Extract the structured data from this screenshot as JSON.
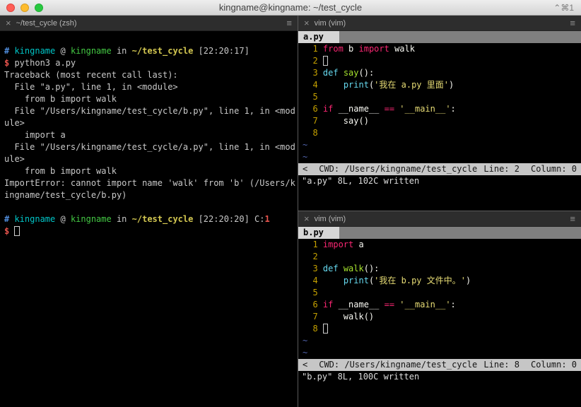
{
  "titlebar": {
    "title": "kingname@kingname: ~/test_cycle",
    "shortcut": "⌃⌘1"
  },
  "colors": {
    "traffic_red": "#ff5f57",
    "traffic_yellow": "#febc2e",
    "traffic_green": "#28c840",
    "keyword_pink": "#f92672",
    "builtin_cyan": "#66d9ef",
    "function_green": "#a6e22e",
    "string_yellow": "#e6db74",
    "line_number_yellow": "#c4a000",
    "prompt_path_yellow": "#d3c751",
    "prompt_red": "#e8544d",
    "statusline_gray": "#c6c6c6"
  },
  "left_pane": {
    "tab": {
      "close": "×",
      "title": "~/test_cycle (zsh)",
      "menu": "≡"
    },
    "lines": [
      [
        {
          "t": "# ",
          "c": "c-blue"
        },
        {
          "t": "kingname",
          "c": "c-cyan"
        },
        {
          "t": " @ ",
          "c": "c-fg"
        },
        {
          "t": "kingname",
          "c": "c-green"
        },
        {
          "t": " in ",
          "c": "c-fg"
        },
        {
          "t": "~/test_cycle",
          "c": "c-yellow"
        },
        {
          "t": " [22:20:17]",
          "c": "c-fg"
        }
      ],
      [
        {
          "t": "$ ",
          "c": "c-red"
        },
        {
          "t": "python3 a.py",
          "c": "c-fg"
        }
      ],
      [
        {
          "t": "Traceback (most recent call last):",
          "c": "c-fg"
        }
      ],
      [
        {
          "t": "  File \"a.py\", line 1, in <module>",
          "c": "c-fg"
        }
      ],
      [
        {
          "t": "    from b import walk",
          "c": "c-fg"
        }
      ],
      [
        {
          "t": "  File \"/Users/kingname/test_cycle/b.py\", line 1, in <mod",
          "c": "c-fg"
        }
      ],
      [
        {
          "t": "ule>",
          "c": "c-fg"
        }
      ],
      [
        {
          "t": "    import a",
          "c": "c-fg"
        }
      ],
      [
        {
          "t": "  File \"/Users/kingname/test_cycle/a.py\", line 1, in <mod",
          "c": "c-fg"
        }
      ],
      [
        {
          "t": "ule>",
          "c": "c-fg"
        }
      ],
      [
        {
          "t": "    from b import walk",
          "c": "c-fg"
        }
      ],
      [
        {
          "t": "ImportError: cannot import name 'walk' from 'b' (/Users/k",
          "c": "c-fg"
        }
      ],
      [
        {
          "t": "ingname/test_cycle/b.py)",
          "c": "c-fg"
        }
      ],
      [
        {
          "t": " ",
          "c": "c-fg"
        }
      ],
      [
        {
          "t": "# ",
          "c": "c-blue"
        },
        {
          "t": "kingname",
          "c": "c-cyan"
        },
        {
          "t": " @ ",
          "c": "c-fg"
        },
        {
          "t": "kingname",
          "c": "c-green"
        },
        {
          "t": " in ",
          "c": "c-fg"
        },
        {
          "t": "~/test_cycle",
          "c": "c-yellow"
        },
        {
          "t": " [22:20:20] ",
          "c": "c-fg"
        },
        {
          "t": "C:",
          "c": "c-fg"
        },
        {
          "t": "1",
          "c": "c-red"
        }
      ],
      [
        {
          "t": "$ ",
          "c": "c-red"
        },
        {
          "t": " ",
          "c": "cursor"
        }
      ]
    ]
  },
  "vim_a": {
    "tab": {
      "close": "×",
      "title": "vim (vim)",
      "menu": "≡"
    },
    "file_tab": "a.py",
    "code": [
      [
        {
          "t": "  1 ",
          "c": "ln"
        },
        {
          "t": "from",
          "c": "kw"
        },
        {
          "t": " b ",
          "c": "fg"
        },
        {
          "t": "import",
          "c": "kw"
        },
        {
          "t": " walk",
          "c": "fg"
        }
      ],
      [
        {
          "t": "  2 ",
          "c": "ln"
        },
        {
          "t": " ",
          "c": "cursor"
        }
      ],
      [
        {
          "t": "  3 ",
          "c": "ln"
        },
        {
          "t": "def",
          "c": "ty"
        },
        {
          "t": " ",
          "c": "fg"
        },
        {
          "t": "say",
          "c": "fn"
        },
        {
          "t": "():",
          "c": "fg"
        }
      ],
      [
        {
          "t": "  4 ",
          "c": "ln"
        },
        {
          "t": "    ",
          "c": "fg"
        },
        {
          "t": "print",
          "c": "ty"
        },
        {
          "t": "(",
          "c": "fg"
        },
        {
          "t": "'我在 a.py 里面'",
          "c": "st"
        },
        {
          "t": ")",
          "c": "fg"
        }
      ],
      [
        {
          "t": "  5 ",
          "c": "ln"
        }
      ],
      [
        {
          "t": "  6 ",
          "c": "ln"
        },
        {
          "t": "if",
          "c": "kw"
        },
        {
          "t": " __name__ ",
          "c": "fg"
        },
        {
          "t": "==",
          "c": "kw"
        },
        {
          "t": " ",
          "c": "fg"
        },
        {
          "t": "'__main__'",
          "c": "st"
        },
        {
          "t": ":",
          "c": "fg"
        }
      ],
      [
        {
          "t": "  7 ",
          "c": "ln"
        },
        {
          "t": "    say()",
          "c": "fg"
        }
      ],
      [
        {
          "t": "  8 ",
          "c": "ln"
        }
      ],
      [
        {
          "t": "~",
          "c": "tilde"
        }
      ],
      [
        {
          "t": "~",
          "c": "tilde"
        }
      ]
    ],
    "status": {
      "back": "<",
      "cwd": "CWD: /Users/kingname/test_cycle",
      "line": "Line: 2",
      "column": "Column: 0"
    },
    "message": "\"a.py\" 8L, 102C written"
  },
  "vim_b": {
    "tab": {
      "close": "×",
      "title": "vim (vim)",
      "menu": "≡"
    },
    "file_tab": "b.py",
    "code": [
      [
        {
          "t": "  1 ",
          "c": "ln"
        },
        {
          "t": "import",
          "c": "kw"
        },
        {
          "t": " a",
          "c": "fg"
        }
      ],
      [
        {
          "t": "  2 ",
          "c": "ln"
        }
      ],
      [
        {
          "t": "  3 ",
          "c": "ln"
        },
        {
          "t": "def",
          "c": "ty"
        },
        {
          "t": " ",
          "c": "fg"
        },
        {
          "t": "walk",
          "c": "fn"
        },
        {
          "t": "():",
          "c": "fg"
        }
      ],
      [
        {
          "t": "  4 ",
          "c": "ln"
        },
        {
          "t": "    ",
          "c": "fg"
        },
        {
          "t": "print",
          "c": "ty"
        },
        {
          "t": "(",
          "c": "fg"
        },
        {
          "t": "'我在 b.py 文件中。'",
          "c": "st"
        },
        {
          "t": ")",
          "c": "fg"
        }
      ],
      [
        {
          "t": "  5 ",
          "c": "ln"
        }
      ],
      [
        {
          "t": "  6 ",
          "c": "ln"
        },
        {
          "t": "if",
          "c": "kw"
        },
        {
          "t": " __name__ ",
          "c": "fg"
        },
        {
          "t": "==",
          "c": "kw"
        },
        {
          "t": " ",
          "c": "fg"
        },
        {
          "t": "'__main__'",
          "c": "st"
        },
        {
          "t": ":",
          "c": "fg"
        }
      ],
      [
        {
          "t": "  7 ",
          "c": "ln"
        },
        {
          "t": "    walk()",
          "c": "fg"
        }
      ],
      [
        {
          "t": "  8 ",
          "c": "ln"
        },
        {
          "t": " ",
          "c": "cursor"
        }
      ],
      [
        {
          "t": "~",
          "c": "tilde"
        }
      ],
      [
        {
          "t": "~",
          "c": "tilde"
        }
      ]
    ],
    "status": {
      "back": "<",
      "cwd": "CWD: /Users/kingname/test_cycle",
      "line": "Line: 8",
      "column": "Column: 0"
    },
    "message": "\"b.py\" 8L, 100C written"
  }
}
